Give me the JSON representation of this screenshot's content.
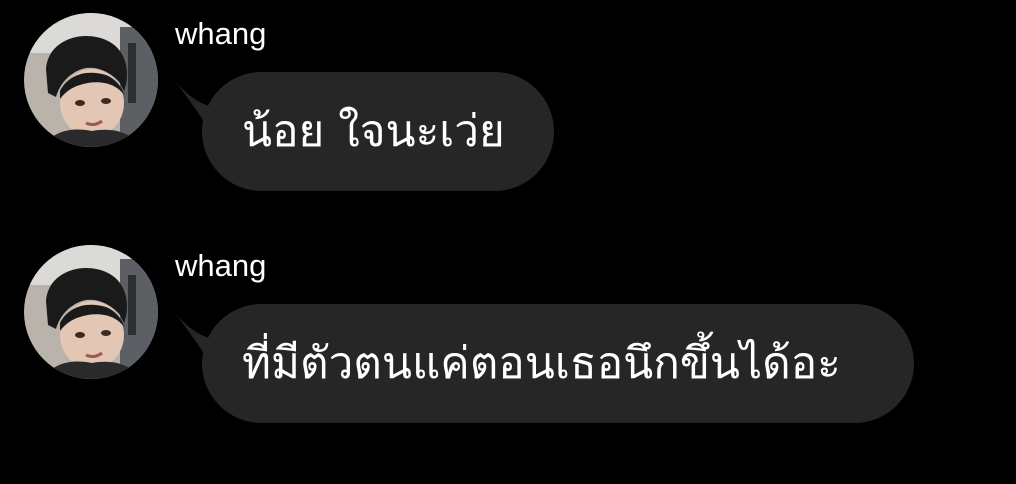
{
  "messages": [
    {
      "sender": "whang",
      "text": "น้อย ใจนะเว่ย",
      "avatar_icon": "user-avatar-photo"
    },
    {
      "sender": "whang",
      "text": "ที่มีตัวตนแค่ตอนเธอนึกขึ้นได้อะ",
      "avatar_icon": "user-avatar-photo"
    }
  ],
  "colors": {
    "background": "#000000",
    "bubble": "#262626",
    "text": "#ffffff"
  }
}
